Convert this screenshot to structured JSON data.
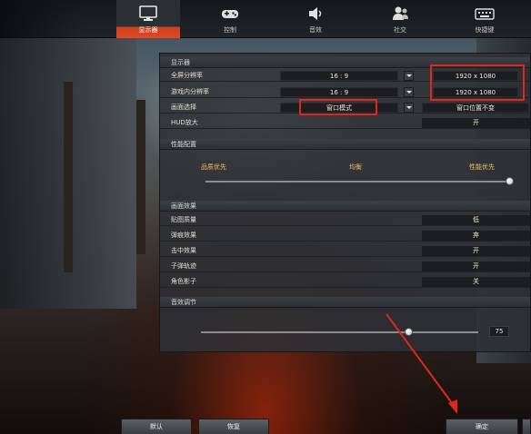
{
  "tabs": [
    {
      "label": "显示器",
      "icon": "monitor-icon",
      "active": true
    },
    {
      "label": "控制",
      "icon": "gamepad-icon",
      "active": false
    },
    {
      "label": "音效",
      "icon": "speaker-icon",
      "active": false
    },
    {
      "label": "社交",
      "icon": "people-icon",
      "active": false
    },
    {
      "label": "快捷键",
      "icon": "keyboard-icon",
      "active": false
    }
  ],
  "display": {
    "header": "显示器",
    "rows": [
      {
        "label": "全屏分辨率",
        "ratio": "16 : 9",
        "resolution": "1920 x 1080"
      },
      {
        "label": "游戏内分辨率",
        "ratio": "16 : 9",
        "resolution": "1920 x 1080"
      },
      {
        "label": "画面选择",
        "mode": "窗口模式",
        "mode_extra": "窗口位置不变"
      },
      {
        "label": "HUD放大",
        "value": "开"
      }
    ]
  },
  "quality": {
    "header": "性能配置",
    "left": "品质优先",
    "middle": "均衡",
    "right": "性能优先",
    "level": 1.0
  },
  "effects": {
    "header": "画面效果",
    "rows": [
      {
        "label": "贴图质量",
        "value": "低"
      },
      {
        "label": "弹痕效果",
        "value": "弃"
      },
      {
        "label": "击中效果",
        "value": "开"
      },
      {
        "label": "子弹轨迹",
        "value": "开"
      },
      {
        "label": "角色影子",
        "value": "关"
      }
    ]
  },
  "volume": {
    "header": "音效调节",
    "value": "75",
    "level": 0.75
  },
  "buttons": {
    "default": "默认",
    "restore": "恢复",
    "confirm": "确定"
  },
  "colors": {
    "accent": "#e04a22",
    "highlight": "#e0261d"
  }
}
